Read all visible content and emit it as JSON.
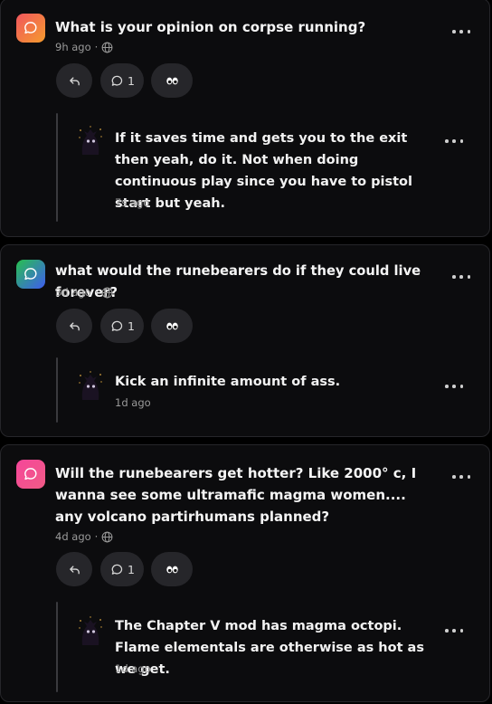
{
  "posts": [
    {
      "question": "What is your opinion on corpse running?",
      "time": "9h ago",
      "reply_count": "1",
      "emoji_icon": "eyes-icon",
      "avatar_gradient": [
        "#f0565e",
        "#f59b2d"
      ],
      "reply": {
        "text": "If it saves time and gets you to the exit then yeah, do it. Not when doing continuous play since you have to pistol start but yeah.",
        "time": "7s ago"
      }
    },
    {
      "question": "what would the runebearers do if they could live forever?",
      "time": "3d ago",
      "reply_count": "1",
      "emoji_icon": "eyes-icon",
      "avatar_gradient": [
        "#27c04f",
        "#3f5cf0"
      ],
      "reply": {
        "text": "Kick an infinite amount of ass.",
        "time": "1d ago"
      }
    },
    {
      "question": "Will the runebearers get hotter? Like 2000° c, I wanna see some ultramafic magma women.... any volcano partirhumans planned?",
      "time": "4d ago",
      "reply_count": "1",
      "emoji_icon": "eyes-icon",
      "avatar_gradient": [
        "#f5469a",
        "#f15b86"
      ],
      "reply": {
        "text": "The Chapter V mod has magma octopi. Flame elementals are otherwise as hot as we get.",
        "time": "1d ago"
      }
    }
  ]
}
